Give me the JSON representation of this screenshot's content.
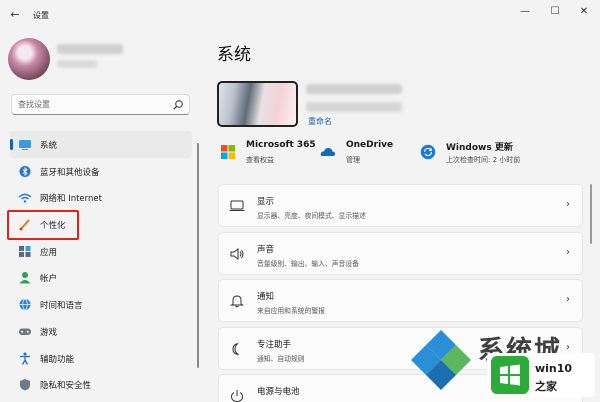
{
  "window": {
    "title": "设置",
    "back_icon": "back-arrow-icon",
    "min_label": "—",
    "max_label": "☐",
    "close_label": "✕"
  },
  "search": {
    "placeholder": "查找设置"
  },
  "sidebar": {
    "items": [
      {
        "label": "系统",
        "icon": "system-icon",
        "active": true
      },
      {
        "label": "蓝牙和其他设备",
        "icon": "bluetooth-icon"
      },
      {
        "label": "网络和 Internet",
        "icon": "wifi-icon"
      },
      {
        "label": "个性化",
        "icon": "brush-icon",
        "highlighted": true
      },
      {
        "label": "应用",
        "icon": "apps-icon"
      },
      {
        "label": "帐户",
        "icon": "account-icon"
      },
      {
        "label": "时间和语言",
        "icon": "globe-icon"
      },
      {
        "label": "游戏",
        "icon": "gamepad-icon"
      },
      {
        "label": "辅助功能",
        "icon": "accessibility-icon"
      },
      {
        "label": "隐私和安全性",
        "icon": "shield-icon"
      }
    ]
  },
  "main": {
    "title": "系统",
    "rename_label": "重命名",
    "status": [
      {
        "title": "Microsoft 365",
        "subtitle": "查看权益",
        "icon": "microsoft365-icon"
      },
      {
        "title": "OneDrive",
        "subtitle": "管理",
        "icon": "onedrive-icon"
      },
      {
        "title": "Windows 更新",
        "subtitle": "上次检查时间: 2 小时前",
        "icon": "windows-update-icon"
      }
    ],
    "cards": [
      {
        "title": "显示",
        "subtitle": "显示器、亮度、夜间模式、显示描述",
        "icon": "display-icon"
      },
      {
        "title": "声音",
        "subtitle": "音量级别、输出、输入、声音设备",
        "icon": "speaker-icon"
      },
      {
        "title": "通知",
        "subtitle": "来自应用和系统的警报",
        "icon": "bell-icon"
      },
      {
        "title": "专注助手",
        "subtitle": "通知、自动规则",
        "icon": "moon-icon"
      },
      {
        "title": "电源与电池",
        "subtitle": "",
        "icon": "power-icon"
      }
    ]
  },
  "watermark": {
    "text_big": "系统城",
    "site_line1": "win10",
    "site_line2": "之家"
  },
  "colors": {
    "accent": "#1a5fb4",
    "highlight_box": "#e0241a",
    "background": "#f3f3f3"
  }
}
